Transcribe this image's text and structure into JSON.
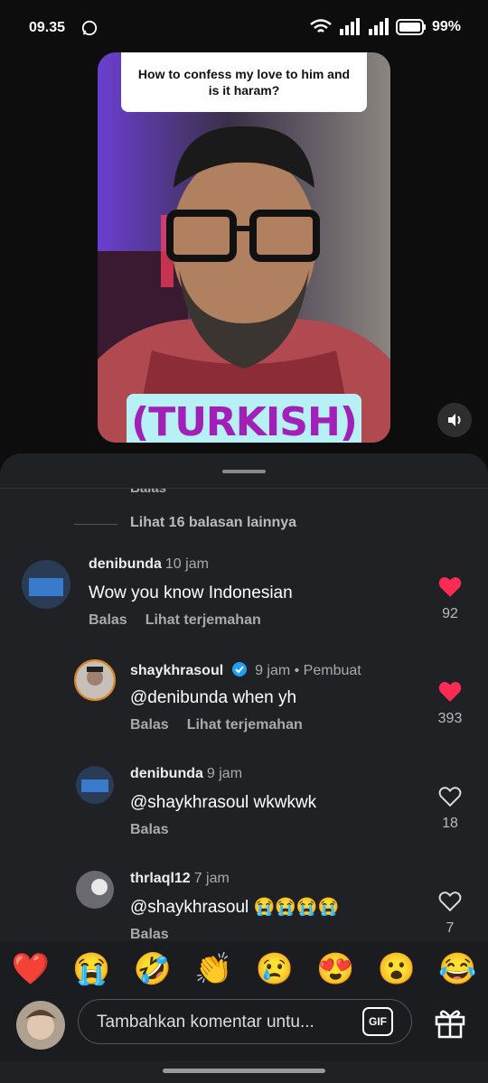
{
  "status": {
    "time": "09.35",
    "battery": "99%"
  },
  "video": {
    "question": "How to confess my love to him and is it haram?",
    "caption": "(TURKISH)"
  },
  "comments": {
    "partial_reply": "Balas",
    "more_replies": "Lihat 16 balasan lainnya",
    "items": [
      {
        "user": "denibunda",
        "meta": "10 jam",
        "text": "Wow you know Indonesian",
        "reply": "Balas",
        "translate": "Lihat terjemahan",
        "likes": "92",
        "liked": true
      },
      {
        "user": "shaykhrasoul",
        "meta": "9 jam • Pembuat",
        "text": "@denibunda when yh",
        "reply": "Balas",
        "translate": "Lihat terjemahan",
        "likes": "393",
        "liked": true
      },
      {
        "user": "denibunda",
        "meta": "9 jam",
        "text": "@shaykhrasoul wkwkwk",
        "reply": "Balas",
        "likes": "18",
        "liked": false
      },
      {
        "user": "thrlaql12",
        "meta": "7 jam",
        "text": "@shaykhrasoul 😭😭😭😭",
        "reply": "Balas",
        "likes": "7",
        "liked": false
      }
    ]
  },
  "emoji_bar": [
    "❤️",
    "😭",
    "🤣",
    "👏",
    "😢",
    "😍",
    "😮",
    "😂"
  ],
  "composer": {
    "placeholder": "Tambahkan komentar untu...",
    "gif": "GIF"
  },
  "colors": {
    "like_red": "#fe2c55",
    "sheet_bg": "#1f2124",
    "verified_blue": "#20a0f0"
  }
}
